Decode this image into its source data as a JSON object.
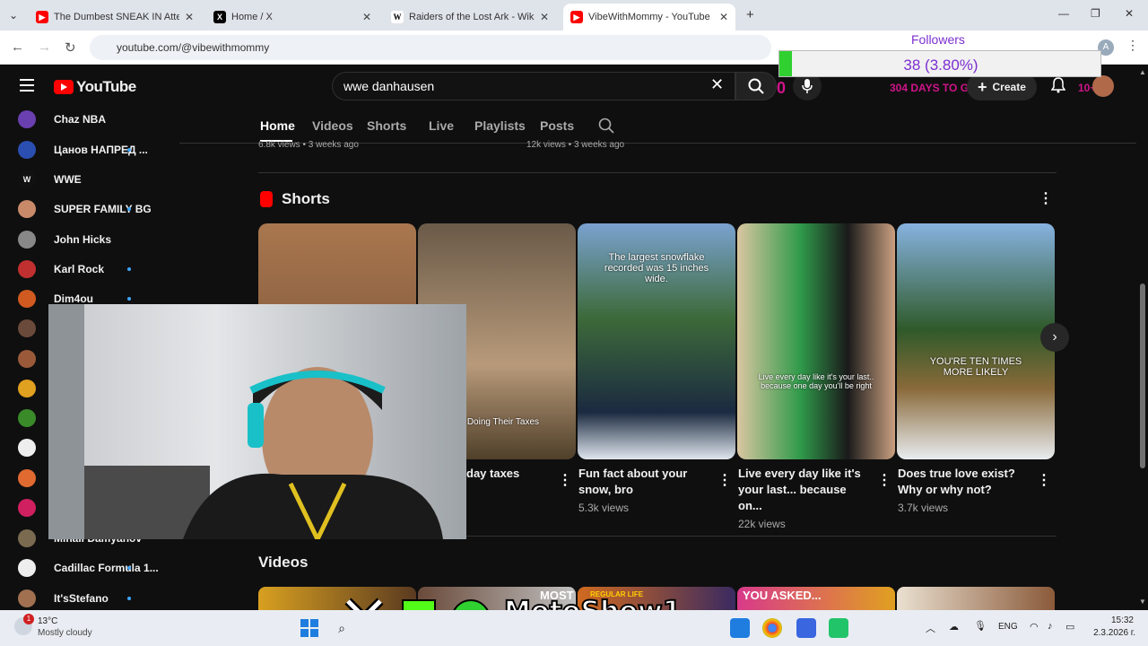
{
  "browser": {
    "tabs": [
      {
        "title": "The Dumbest SNEAK IN Attemp",
        "icon": "youtube-icon"
      },
      {
        "title": "Home / X",
        "icon": "x-icon"
      },
      {
        "title": "Raiders of the Lost Ark - Wikipe",
        "icon": "wikipedia-icon"
      },
      {
        "title": "VibeWithMommy - YouTube",
        "icon": "youtube-icon"
      }
    ],
    "new_tab": "+",
    "url": "youtube.com/@vibewithmommy"
  },
  "youtube": {
    "logo_text": "YouTube",
    "search_value": "wwe danhausen",
    "create_label": "Create",
    "notif_count": "10+"
  },
  "overlay": {
    "followers_label": "Followers",
    "followers_value": "38 (3.80%)",
    "followers_fraction": 0.038,
    "days_to_go": "304 DAYS TO GO",
    "zero": "0"
  },
  "sidebar": {
    "items": [
      {
        "label": "Chaz NBA",
        "dot": false,
        "color": "#6a3fb0"
      },
      {
        "label": "Цанов НАПРЕД ...",
        "dot": true,
        "color": "#2a4fb0"
      },
      {
        "label": "WWE",
        "dot": false,
        "color": "#111111"
      },
      {
        "label": "SUPER FAMILY BG",
        "dot": true,
        "color": "#c98a6a"
      },
      {
        "label": "John Hicks",
        "dot": false,
        "color": "#888888"
      },
      {
        "label": "Karl Rock",
        "dot": true,
        "color": "#c03030"
      },
      {
        "label": "Dim4ou",
        "dot": true,
        "color": "#d05a20"
      },
      {
        "label": "Mihail Damyanov",
        "dot": true,
        "color": "#7a6a50"
      },
      {
        "label": "Cadillac Formula 1...",
        "dot": true,
        "color": "#eeeeee"
      },
      {
        "label": "It'sStefano",
        "dot": true,
        "color": "#a07050"
      }
    ]
  },
  "channel_tabs": [
    "Home",
    "Videos",
    "Shorts",
    "Live",
    "Playlists",
    "Posts"
  ],
  "prev_views": [
    "6.8k views • 3 weeks ago",
    "12k views • 3 weeks ago"
  ],
  "shorts_section": {
    "title": "Shorts",
    "items": [
      {
        "title": "",
        "views": "",
        "overlay": ""
      },
      {
        "title": "day taxes",
        "views": "",
        "overlay": "en Doing Their Taxes"
      },
      {
        "title": "Fun fact about your snow, bro",
        "views": "5.3k views",
        "overlay": "The largest snowflake recorded was 15 inches wide."
      },
      {
        "title": "Live every day like it's your last... because on...",
        "views": "22k views",
        "overlay": "Live every day like it's your last.. because one day you'll be right"
      },
      {
        "title": "Does true love exist? Why or why not?",
        "views": "3.7k views",
        "overlay": "YOU'RE TEN TIMES MORE LIKELY"
      }
    ]
  },
  "videos_section": {
    "title": "Videos",
    "thumb_texts": [
      "",
      "MOST",
      "REGULAR LIFE",
      "YOU ASKED...",
      ""
    ]
  },
  "stream_overlay": {
    "text": "MotoShow1"
  },
  "taskbar": {
    "weather_temp": "13°C",
    "weather_desc": "Mostly cloudy",
    "weather_badge": "1",
    "lang": "ENG",
    "time": "15:32",
    "date": "2.3.2026 г."
  }
}
